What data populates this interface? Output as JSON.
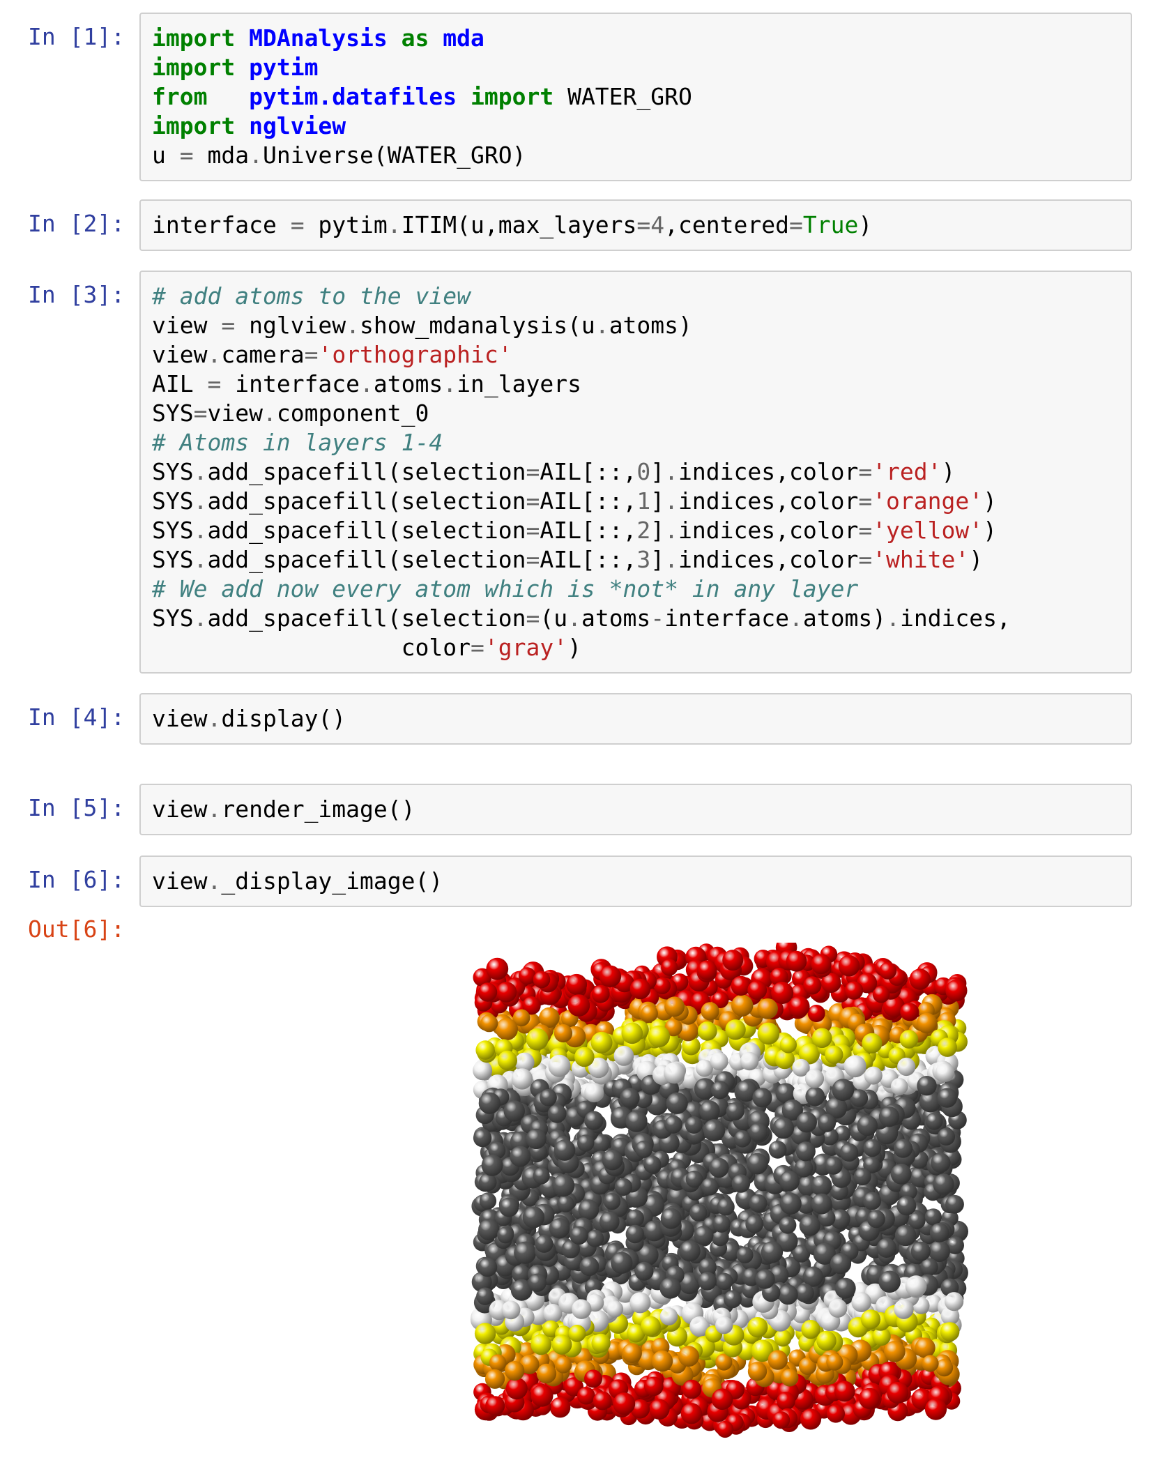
{
  "cells": [
    {
      "prompt": "In [1]:",
      "lines": [
        [
          {
            "t": "import",
            "c": "kw"
          },
          {
            "t": " ",
            "c": ""
          },
          {
            "t": "MDAnalysis",
            "c": "ns"
          },
          {
            "t": " ",
            "c": ""
          },
          {
            "t": "as",
            "c": "kw"
          },
          {
            "t": " ",
            "c": ""
          },
          {
            "t": "mda",
            "c": "ns"
          }
        ],
        [
          {
            "t": "import",
            "c": "kw"
          },
          {
            "t": " ",
            "c": ""
          },
          {
            "t": "pytim",
            "c": "ns"
          }
        ],
        [
          {
            "t": "from",
            "c": "kw"
          },
          {
            "t": "   ",
            "c": ""
          },
          {
            "t": "pytim.datafiles",
            "c": "ns"
          },
          {
            "t": " ",
            "c": ""
          },
          {
            "t": "import",
            "c": "kw"
          },
          {
            "t": " WATER_GRO",
            "c": ""
          }
        ],
        [
          {
            "t": "import",
            "c": "kw"
          },
          {
            "t": " ",
            "c": ""
          },
          {
            "t": "nglview",
            "c": "ns"
          }
        ],
        [
          {
            "t": "u ",
            "c": ""
          },
          {
            "t": "=",
            "c": "op"
          },
          {
            "t": " mda",
            "c": ""
          },
          {
            "t": ".",
            "c": "op"
          },
          {
            "t": "Universe(WATER_GRO)",
            "c": ""
          }
        ]
      ]
    },
    {
      "prompt": "In [2]:",
      "lines": [
        [
          {
            "t": "interface ",
            "c": ""
          },
          {
            "t": "=",
            "c": "op"
          },
          {
            "t": " pytim",
            "c": ""
          },
          {
            "t": ".",
            "c": "op"
          },
          {
            "t": "ITIM(u,max_layers",
            "c": ""
          },
          {
            "t": "=",
            "c": "op"
          },
          {
            "t": "4",
            "c": "nm"
          },
          {
            "t": ",centered",
            "c": ""
          },
          {
            "t": "=",
            "c": "op"
          },
          {
            "t": "True",
            "c": "bi"
          },
          {
            "t": ")",
            "c": ""
          }
        ]
      ]
    },
    {
      "prompt": "In [3]:",
      "lines": [
        [
          {
            "t": "# add atoms to the view",
            "c": "cm"
          }
        ],
        [
          {
            "t": "view ",
            "c": ""
          },
          {
            "t": "=",
            "c": "op"
          },
          {
            "t": " nglview",
            "c": ""
          },
          {
            "t": ".",
            "c": "op"
          },
          {
            "t": "show_mdanalysis(u",
            "c": ""
          },
          {
            "t": ".",
            "c": "op"
          },
          {
            "t": "atoms)",
            "c": ""
          }
        ],
        [
          {
            "t": "view",
            "c": ""
          },
          {
            "t": ".",
            "c": "op"
          },
          {
            "t": "camera",
            "c": ""
          },
          {
            "t": "=",
            "c": "op"
          },
          {
            "t": "'orthographic'",
            "c": "st"
          }
        ],
        [
          {
            "t": "AIL ",
            "c": ""
          },
          {
            "t": "=",
            "c": "op"
          },
          {
            "t": " interface",
            "c": ""
          },
          {
            "t": ".",
            "c": "op"
          },
          {
            "t": "atoms",
            "c": ""
          },
          {
            "t": ".",
            "c": "op"
          },
          {
            "t": "in_layers",
            "c": ""
          }
        ],
        [
          {
            "t": "SYS",
            "c": ""
          },
          {
            "t": "=",
            "c": "op"
          },
          {
            "t": "view",
            "c": ""
          },
          {
            "t": ".",
            "c": "op"
          },
          {
            "t": "component_0",
            "c": ""
          }
        ],
        [
          {
            "t": "# Atoms in layers 1-4",
            "c": "cm"
          }
        ],
        [
          {
            "t": "SYS",
            "c": ""
          },
          {
            "t": ".",
            "c": "op"
          },
          {
            "t": "add_spacefill(selection",
            "c": ""
          },
          {
            "t": "=",
            "c": "op"
          },
          {
            "t": "AIL[::,",
            "c": ""
          },
          {
            "t": "0",
            "c": "nm"
          },
          {
            "t": "]",
            "c": ""
          },
          {
            "t": ".",
            "c": "op"
          },
          {
            "t": "indices,color",
            "c": ""
          },
          {
            "t": "=",
            "c": "op"
          },
          {
            "t": "'red'",
            "c": "st"
          },
          {
            "t": ")",
            "c": ""
          }
        ],
        [
          {
            "t": "SYS",
            "c": ""
          },
          {
            "t": ".",
            "c": "op"
          },
          {
            "t": "add_spacefill(selection",
            "c": ""
          },
          {
            "t": "=",
            "c": "op"
          },
          {
            "t": "AIL[::,",
            "c": ""
          },
          {
            "t": "1",
            "c": "nm"
          },
          {
            "t": "]",
            "c": ""
          },
          {
            "t": ".",
            "c": "op"
          },
          {
            "t": "indices,color",
            "c": ""
          },
          {
            "t": "=",
            "c": "op"
          },
          {
            "t": "'orange'",
            "c": "st"
          },
          {
            "t": ")",
            "c": ""
          }
        ],
        [
          {
            "t": "SYS",
            "c": ""
          },
          {
            "t": ".",
            "c": "op"
          },
          {
            "t": "add_spacefill(selection",
            "c": ""
          },
          {
            "t": "=",
            "c": "op"
          },
          {
            "t": "AIL[::,",
            "c": ""
          },
          {
            "t": "2",
            "c": "nm"
          },
          {
            "t": "]",
            "c": ""
          },
          {
            "t": ".",
            "c": "op"
          },
          {
            "t": "indices,color",
            "c": ""
          },
          {
            "t": "=",
            "c": "op"
          },
          {
            "t": "'yellow'",
            "c": "st"
          },
          {
            "t": ")",
            "c": ""
          }
        ],
        [
          {
            "t": "SYS",
            "c": ""
          },
          {
            "t": ".",
            "c": "op"
          },
          {
            "t": "add_spacefill(selection",
            "c": ""
          },
          {
            "t": "=",
            "c": "op"
          },
          {
            "t": "AIL[::,",
            "c": ""
          },
          {
            "t": "3",
            "c": "nm"
          },
          {
            "t": "]",
            "c": ""
          },
          {
            "t": ".",
            "c": "op"
          },
          {
            "t": "indices,color",
            "c": ""
          },
          {
            "t": "=",
            "c": "op"
          },
          {
            "t": "'white'",
            "c": "st"
          },
          {
            "t": ")",
            "c": ""
          }
        ],
        [
          {
            "t": "# We add now every atom which is *not* in any layer",
            "c": "cm"
          }
        ],
        [
          {
            "t": "SYS",
            "c": ""
          },
          {
            "t": ".",
            "c": "op"
          },
          {
            "t": "add_spacefill(selection",
            "c": ""
          },
          {
            "t": "=",
            "c": "op"
          },
          {
            "t": "(u",
            "c": ""
          },
          {
            "t": ".",
            "c": "op"
          },
          {
            "t": "atoms",
            "c": ""
          },
          {
            "t": "-",
            "c": "op"
          },
          {
            "t": "interface",
            "c": ""
          },
          {
            "t": ".",
            "c": "op"
          },
          {
            "t": "atoms)",
            "c": ""
          },
          {
            "t": ".",
            "c": "op"
          },
          {
            "t": "indices,",
            "c": ""
          }
        ],
        [
          {
            "t": "                  color",
            "c": ""
          },
          {
            "t": "=",
            "c": "op"
          },
          {
            "t": "'gray'",
            "c": "st"
          },
          {
            "t": ")",
            "c": ""
          }
        ]
      ]
    },
    {
      "prompt": "In [4]:",
      "lines": [
        [
          {
            "t": "view",
            "c": ""
          },
          {
            "t": ".",
            "c": "op"
          },
          {
            "t": "display()",
            "c": ""
          }
        ]
      ]
    },
    {
      "prompt": "In [5]:",
      "lines": [
        [
          {
            "t": "view",
            "c": ""
          },
          {
            "t": ".",
            "c": "op"
          },
          {
            "t": "render_image()",
            "c": ""
          }
        ]
      ]
    },
    {
      "prompt": "In [6]:",
      "lines": [
        [
          {
            "t": "view",
            "c": ""
          },
          {
            "t": ".",
            "c": "op"
          },
          {
            "t": "_display_image()",
            "c": ""
          }
        ]
      ]
    }
  ],
  "output": {
    "prompt": "Out[6]:",
    "image": {
      "description_layers": [
        "red",
        "orange",
        "yellow",
        "white",
        "gray",
        "white",
        "yellow",
        "orange",
        "red"
      ],
      "colors": {
        "red": "#e80000",
        "orange": "#f39200",
        "yellow": "#f2ee00",
        "white": "#f2f2f2",
        "gray": "#5a5a5a"
      }
    }
  },
  "theme": {
    "prompt_in_color": "#303f9f",
    "prompt_out_color": "#d84315",
    "cell_bg": "#f7f7f7",
    "cell_border": "#cfcfcf"
  }
}
